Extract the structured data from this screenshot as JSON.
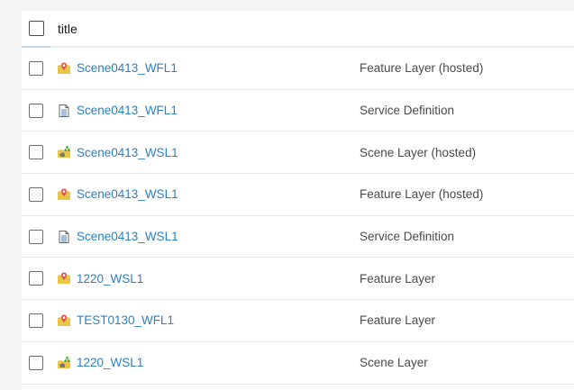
{
  "header": {
    "title_label": "title"
  },
  "rows": [
    {
      "title": "Scene0413_WFL1",
      "type": "Feature Layer (hosted)",
      "icon": "feature-layer-icon"
    },
    {
      "title": "Scene0413_WFL1",
      "type": "Service Definition",
      "icon": "document-icon"
    },
    {
      "title": "Scene0413_WSL1",
      "type": "Scene Layer (hosted)",
      "icon": "scene-layer-icon"
    },
    {
      "title": "Scene0413_WSL1",
      "type": "Feature Layer (hosted)",
      "icon": "feature-layer-icon"
    },
    {
      "title": "Scene0413_WSL1",
      "type": "Service Definition",
      "icon": "document-icon"
    },
    {
      "title": "1220_WSL1",
      "type": "Feature Layer",
      "icon": "feature-layer-icon"
    },
    {
      "title": "TEST0130_WFL1",
      "type": "Feature Layer",
      "icon": "feature-layer-icon"
    },
    {
      "title": "1220_WSL1",
      "type": "Scene Layer",
      "icon": "scene-layer-icon"
    }
  ]
}
